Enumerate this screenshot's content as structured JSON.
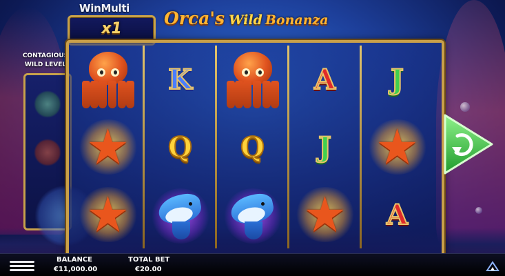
{
  "header": {
    "multiplier_label": "WinMulti",
    "multiplier_value": "x1",
    "logo_part1": "Orca's",
    "logo_part2": "Wild",
    "logo_part3": "Bonanza"
  },
  "meter": {
    "label_line1": "CONTAGIOUS",
    "label_line2": "WILD LEVEL",
    "slots": [
      "turtle",
      "octopus",
      "dolphin"
    ]
  },
  "reels": [
    [
      "octopus",
      "starfish",
      "starfish"
    ],
    [
      "K",
      "Q",
      "dolphin"
    ],
    [
      "octopus",
      "Q",
      "dolphin"
    ],
    [
      "A",
      "J",
      "starfish"
    ],
    [
      "J",
      "starfish",
      "A"
    ]
  ],
  "controls": {
    "spin_icon": "spin-arrow-icon",
    "menu_icon": "hamburger-menu-icon"
  },
  "footer": {
    "balance_label": "BALANCE",
    "balance_value": "€11,000.00",
    "bet_label": "TOTAL BET",
    "bet_value": "€20.00"
  },
  "colors": {
    "frame_gold": "#c9a04a",
    "spin_green": "#3ccf4a",
    "background_blue": "#1d3f9a"
  }
}
